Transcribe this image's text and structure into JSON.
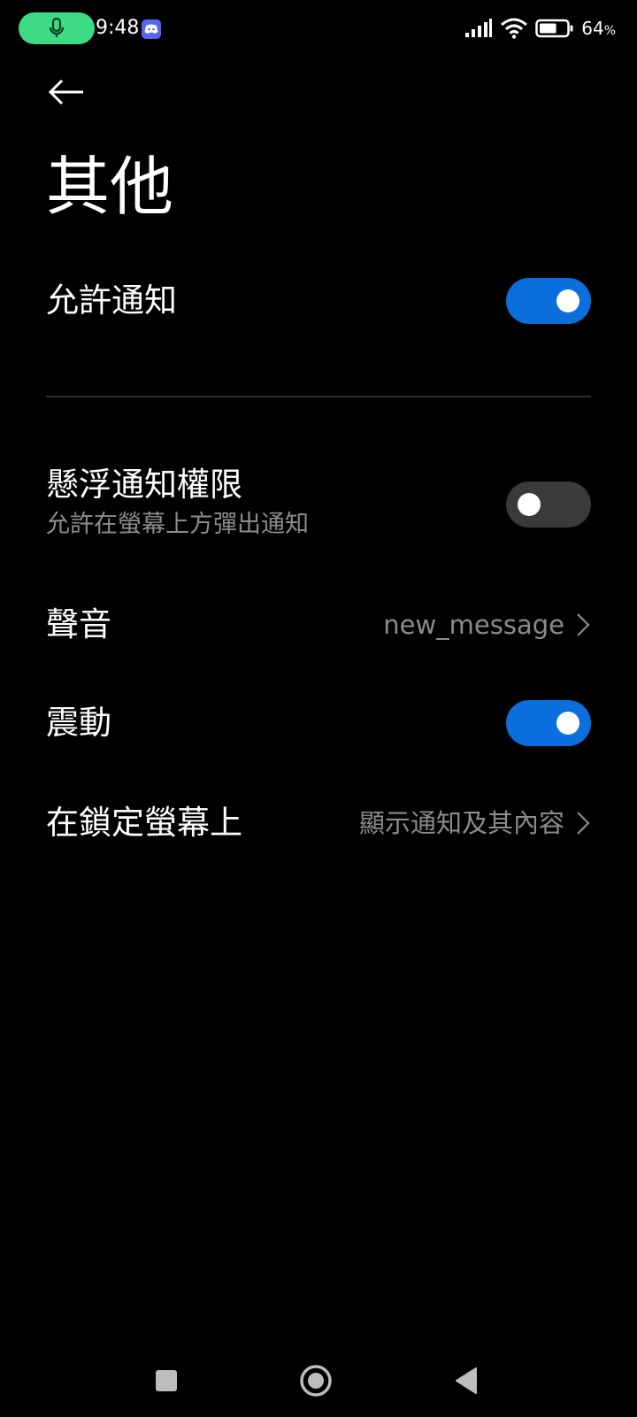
{
  "status_bar": {
    "time": "9:48",
    "battery_percent": "64",
    "battery_unit": "%",
    "battery_level": 0.64,
    "icons": [
      "microphone-icon",
      "discord-icon",
      "signal-icon",
      "wifi-icon",
      "battery-icon"
    ],
    "mic_color": "#3ddc84",
    "discord_color": "#5865f2"
  },
  "header": {
    "back_icon": "arrow-left-icon",
    "title": "其他"
  },
  "settings": {
    "allow_notifications": {
      "label": "允許通知",
      "enabled": true
    },
    "floating_notifications": {
      "label": "懸浮通知權限",
      "description": "允許在螢幕上方彈出通知",
      "enabled": false
    },
    "sound": {
      "label": "聲音",
      "value": "new_message"
    },
    "vibration": {
      "label": "震動",
      "enabled": true
    },
    "lock_screen": {
      "label": "在鎖定螢幕上",
      "value": "顯示通知及其內容"
    }
  },
  "colors": {
    "toggle_on": "#0a6fdc",
    "toggle_off": "#3a3a3a",
    "secondary_text": "#8c8c8c",
    "background": "#000000"
  },
  "nav_bar": {
    "icons": [
      "recents-square-icon",
      "home-circle-icon",
      "back-triangle-icon"
    ]
  }
}
